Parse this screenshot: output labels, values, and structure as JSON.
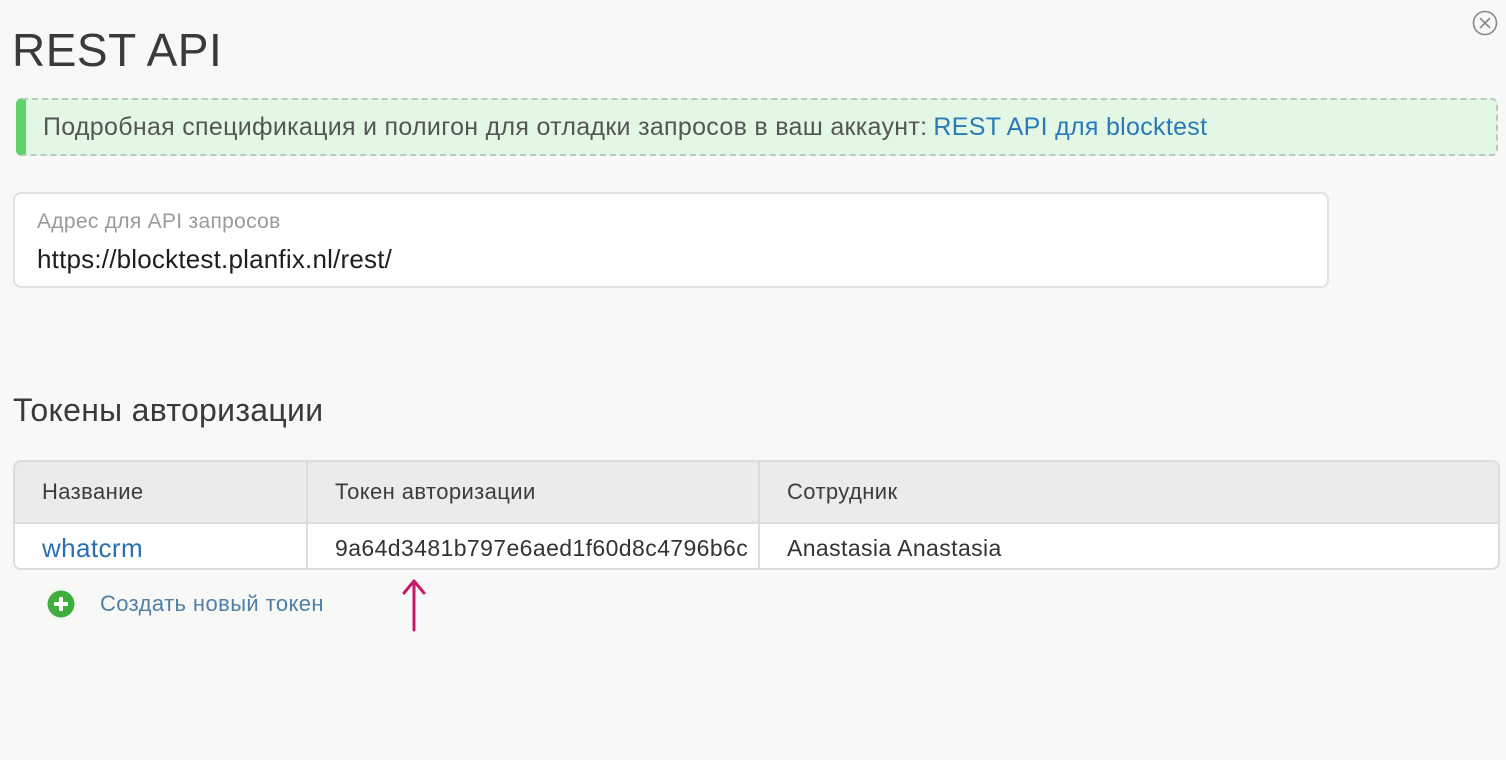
{
  "page": {
    "title": "REST API"
  },
  "banner": {
    "text": "Подробная спецификация и полигон для отладки запросов в ваш аккаунт:",
    "link_text": "REST API для blocktest"
  },
  "api_address": {
    "label": "Адрес для API запросов",
    "value": "https://blocktest.planfix.nl/rest/"
  },
  "tokens": {
    "section_title": "Токены авторизации",
    "columns": [
      "Название",
      "Токен авторизации",
      "Сотрудник"
    ],
    "rows": [
      {
        "name": "whatcrm",
        "token": "9a64d3481b797e6aed1f60d8c4796b6c",
        "employee": "Anastasia Anastasia"
      }
    ],
    "create_label": "Создать новый токен"
  },
  "icons": {
    "close": "close-circle-icon",
    "create": "plus-circle-icon",
    "annotation": "arrow-up-icon"
  },
  "colors": {
    "accent_link": "#2a7ab8",
    "banner_bg": "#e3f7e5",
    "banner_stripe": "#5fd36a",
    "plus_green": "#3fae3f",
    "annotation_arrow": "#c8186e"
  }
}
